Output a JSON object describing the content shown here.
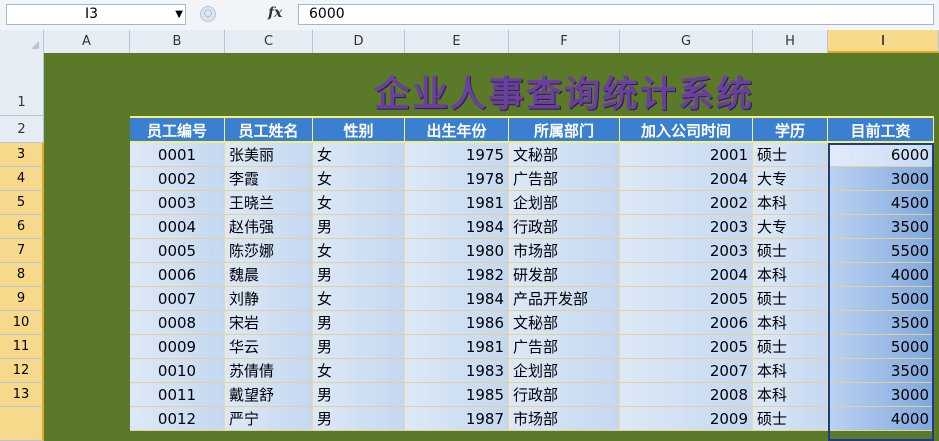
{
  "formula_bar": {
    "cell_ref": "I3",
    "dropdown_glyph": "▼",
    "fx_label": "fx",
    "value": "6000"
  },
  "columns": [
    "A",
    "B",
    "C",
    "D",
    "E",
    "F",
    "G",
    "H",
    "I"
  ],
  "rows": [
    "1",
    "2",
    "3",
    "4",
    "5",
    "6",
    "7",
    "8",
    "9",
    "10",
    "11",
    "12",
    "13"
  ],
  "title": "企业人事查询统计系统",
  "headers": [
    "员工编号",
    "员工姓名",
    "性别",
    "出生年份",
    "所属部门",
    "加入公司时间",
    "学历",
    "目前工资"
  ],
  "records": [
    [
      "0001",
      "张美丽",
      "女",
      "1975",
      "文秘部",
      "2001",
      "硕士",
      "6000"
    ],
    [
      "0002",
      "李霞",
      "女",
      "1978",
      "广告部",
      "2004",
      "大专",
      "3000"
    ],
    [
      "0003",
      "王晓兰",
      "女",
      "1981",
      "企划部",
      "2002",
      "本科",
      "4500"
    ],
    [
      "0004",
      "赵伟强",
      "男",
      "1984",
      "行政部",
      "2003",
      "大专",
      "3500"
    ],
    [
      "0005",
      "陈莎娜",
      "女",
      "1980",
      "市场部",
      "2003",
      "硕士",
      "5500"
    ],
    [
      "0006",
      "魏晨",
      "男",
      "1982",
      "研发部",
      "2004",
      "本科",
      "4000"
    ],
    [
      "0007",
      "刘静",
      "女",
      "1984",
      "产品开发部",
      "2005",
      "硕士",
      "5000"
    ],
    [
      "0008",
      "宋岩",
      "男",
      "1986",
      "文秘部",
      "2006",
      "本科",
      "3500"
    ],
    [
      "0009",
      "华云",
      "男",
      "1981",
      "广告部",
      "2005",
      "硕士",
      "5000"
    ],
    [
      "0010",
      "苏倩倩",
      "女",
      "1983",
      "企划部",
      "2007",
      "本科",
      "3500"
    ],
    [
      "0011",
      "戴望舒",
      "男",
      "1985",
      "行政部",
      "2008",
      "本科",
      "3000"
    ],
    [
      "0012",
      "严宁",
      "男",
      "1987",
      "市场部",
      "2009",
      "硕士",
      "4000"
    ]
  ],
  "colors": {
    "sheet_bg": "#5a7a2a",
    "header_bg": "#3a7fd0",
    "title_color": "#6b3fa0",
    "selection": "#f7d98b"
  }
}
